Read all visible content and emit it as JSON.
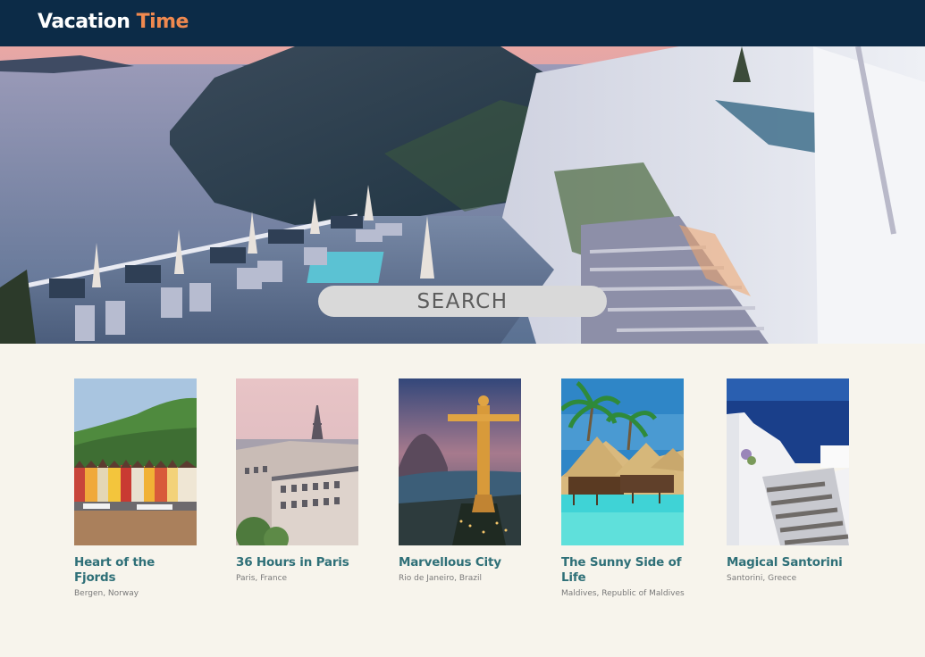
{
  "brand": {
    "name_part1": "Vacation",
    "name_part2": "Time"
  },
  "hero": {
    "search_label": "SEARCH",
    "image": "santorini-terrace-photo"
  },
  "destinations": [
    {
      "title": "Heart of the Fjords",
      "location": "Bergen, Norway",
      "image": "bergen-harbor-photo"
    },
    {
      "title": "36 Hours in Paris",
      "location": "Paris, France",
      "image": "paris-eiffel-photo"
    },
    {
      "title": "Marvellous City",
      "location": "Rio de Janeiro, Brazil",
      "image": "rio-christ-redeemer-photo"
    },
    {
      "title": "The Sunny Side of Life",
      "location": "Maldives, Republic of Maldives",
      "image": "maldives-huts-photo"
    },
    {
      "title": "Magical Santorini",
      "location": "Santorini, Greece",
      "image": "santorini-stairs-photo"
    }
  ],
  "colors": {
    "header_bg": "#0c2b47",
    "accent": "#f0894f",
    "title_teal": "#2f7078",
    "page_bg": "#f7f4ec"
  }
}
